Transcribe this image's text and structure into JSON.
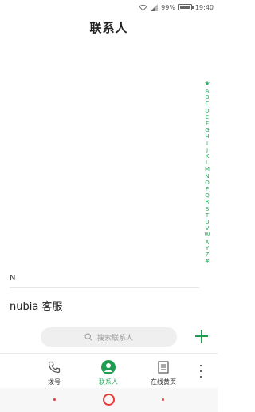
{
  "status_bar": {
    "battery": "99%",
    "time": "19:40"
  },
  "title": "联系人",
  "alpha_index": [
    "★",
    "A",
    "B",
    "C",
    "D",
    "E",
    "F",
    "G",
    "H",
    "I",
    "J",
    "K",
    "L",
    "M",
    "N",
    "O",
    "P",
    "Q",
    "R",
    "S",
    "T",
    "U",
    "V",
    "W",
    "X",
    "Y",
    "Z",
    "#"
  ],
  "section": {
    "header": "N"
  },
  "contacts": [
    {
      "name": "nubia 客服"
    }
  ],
  "search": {
    "placeholder": "搜索联系人"
  },
  "tabs": [
    {
      "label": "拨号",
      "icon": "phone-icon"
    },
    {
      "label": "联系人",
      "icon": "contacts-icon",
      "active": true
    },
    {
      "label": "在线黄页",
      "icon": "yellow-pages-icon"
    }
  ],
  "colors": {
    "accent": "#1f9e52",
    "index": "#2aa85a",
    "nav": "#e53935"
  }
}
